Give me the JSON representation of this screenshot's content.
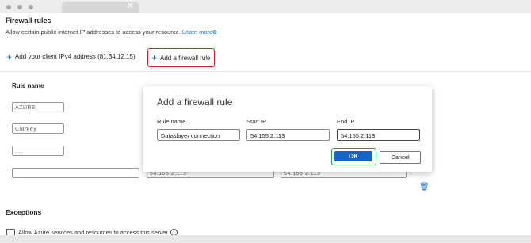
{
  "browser": {
    "tab_close": "✕"
  },
  "section": {
    "title": "Firewall rules",
    "description": "Allow certain public internet IP addresses to access your resource.",
    "learn_more": "Learn more"
  },
  "toolbar": {
    "add_client_label": "Add your client IPv4 address (81.34.12.15)",
    "add_rule_label": "Add a firewall rule"
  },
  "table": {
    "header_rule_name": "Rule name",
    "rows": [
      {
        "rule_name": "AZURE"
      },
      {
        "rule_name": "Clarkey"
      },
      {
        "rule_name": "...."
      },
      {
        "rule_name": "",
        "start_ip": "54.155.2.113",
        "end_ip": "54.155.2.113"
      }
    ]
  },
  "exceptions": {
    "title": "Exceptions",
    "allow_azure_label": "Allow Azure services and resources to access this server",
    "allow_azure_checked": false
  },
  "dialog": {
    "title": "Add a firewall rule",
    "rule_name_label": "Rule name",
    "start_ip_label": "Start IP",
    "end_ip_label": "End IP",
    "rule_name_value": "Dataslayer connection",
    "start_ip_value": "54.155.2.113",
    "end_ip_value": "54.155.2.113",
    "ok_label": "OK",
    "cancel_label": "Cancel"
  },
  "colors": {
    "accent": "#1565c9",
    "highlight_red": "#d9261c",
    "highlight_green": "#2ea14b"
  },
  "icons": {
    "plus": "plus-icon",
    "trash": "trash-icon",
    "info": "info-icon",
    "external": "external-link-icon"
  }
}
